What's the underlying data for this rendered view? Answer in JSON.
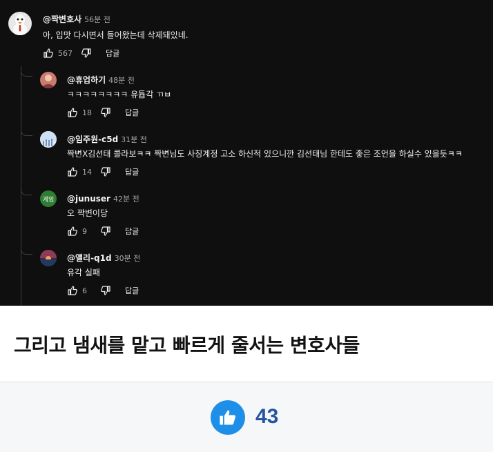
{
  "comments": [
    {
      "author": "@짝변호사",
      "time": "56분 전",
      "text": "아, 입맛 다시면서 들어왔는데 삭제돼있네.",
      "likes": "567",
      "reply_label": "답글",
      "avatar": "duck-lawyer"
    },
    {
      "author": "@휴업하기",
      "time": "48분 전",
      "text": "ㅋㅋㅋㅋㅋㅋㅋㅋ 유튭각 ㄲㅂ",
      "likes": "18",
      "reply_label": "답글",
      "avatar": "person-photo"
    },
    {
      "author": "@임주원-c5d",
      "time": "31분 전",
      "text": "짝변X김선태 콜라보ㅋㅋ 짝변님도 사칭계정 고소 하신적 있으니깐 김선태님 한테도 좋은 조언을 하실수 있을듯ㅋㅋ",
      "likes": "14",
      "reply_label": "답글",
      "avatar": "sky-photo"
    },
    {
      "author": "@junuser",
      "time": "42분 전",
      "text": "오 짝변이당",
      "likes": "9",
      "reply_label": "답글",
      "avatar": "게임",
      "avatar_color": "#2e7d32"
    },
    {
      "author": "@앨리-q1d",
      "time": "30분 전",
      "text": "유각 실패",
      "likes": "6",
      "reply_label": "답글",
      "avatar": "sunset-photo"
    }
  ],
  "headline": "그리고 냄새를 맡고 빠르게 줄서는 변호사들",
  "like": {
    "count": "43",
    "color": "#1e8fe8",
    "icon": "thumbs-up-icon"
  }
}
